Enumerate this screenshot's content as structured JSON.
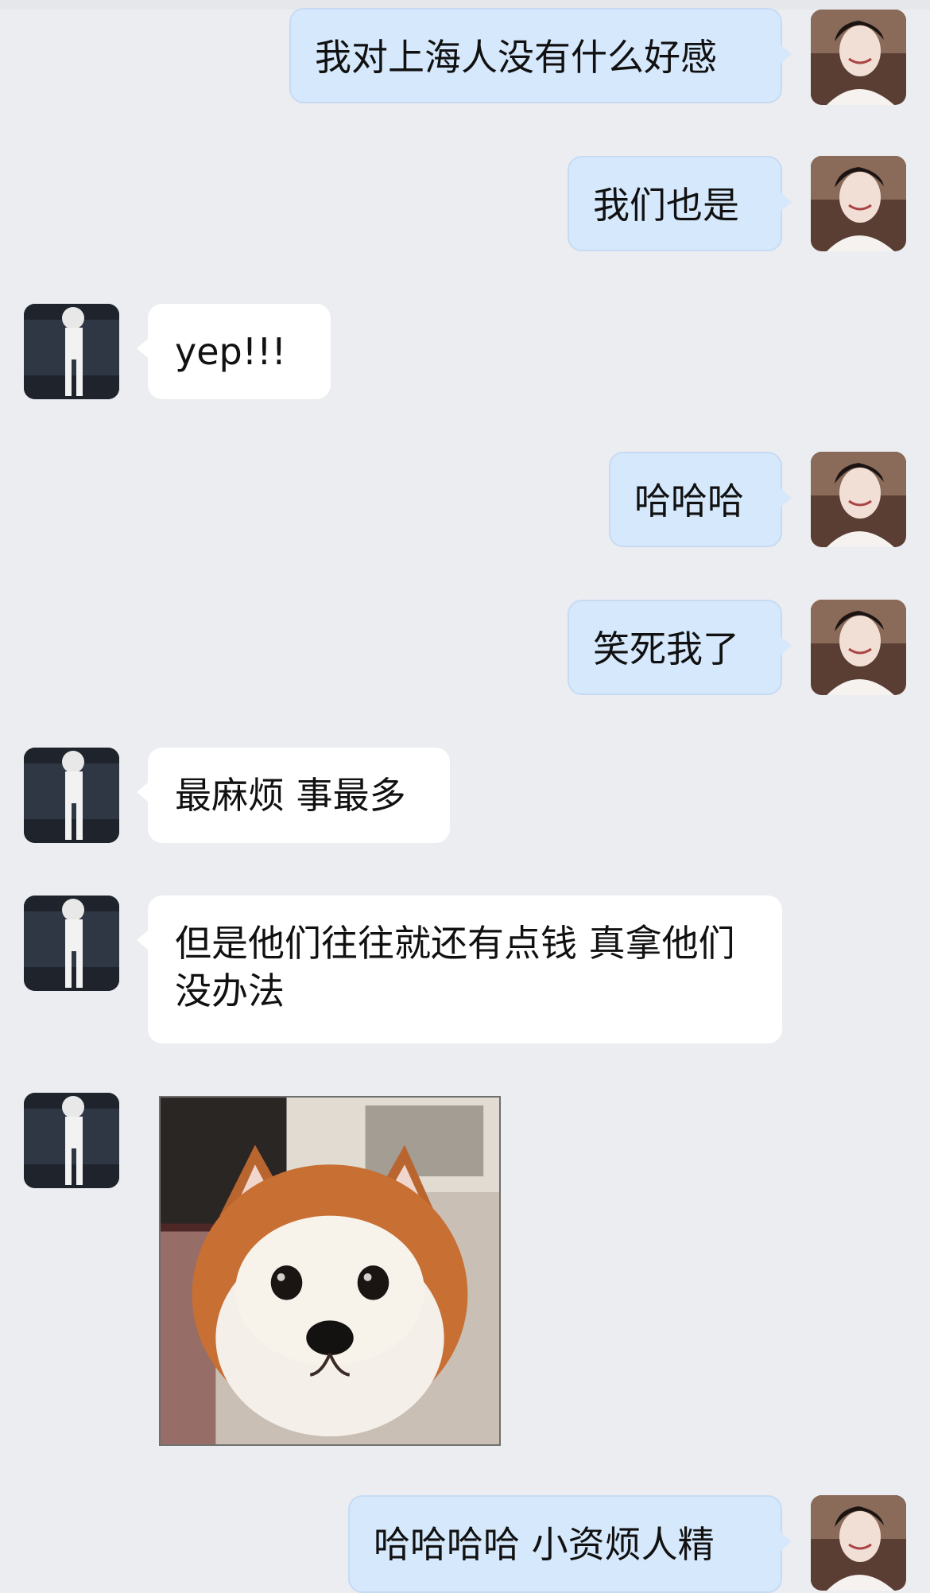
{
  "conversation": {
    "messages": [
      {
        "sender": "me",
        "text": "我对上海人没有什么好感"
      },
      {
        "sender": "me",
        "text": "我们也是"
      },
      {
        "sender": "other",
        "text": "yep!!!"
      },
      {
        "sender": "me",
        "text": "哈哈哈"
      },
      {
        "sender": "me",
        "text": "笑死我了"
      },
      {
        "sender": "other",
        "text": "最麻烦 事最多"
      },
      {
        "sender": "other",
        "text": "但是他们往往就还有点钱 真拿他们没办法"
      },
      {
        "sender": "other",
        "type": "image",
        "image": "shiba-inu-dog-photo"
      },
      {
        "sender": "me",
        "text": "哈哈哈哈 小资烦人精"
      }
    ]
  },
  "colors": {
    "background": "#ECEDF1",
    "my_bubble": "#D6E8FB",
    "their_bubble": "#FFFFFF"
  }
}
